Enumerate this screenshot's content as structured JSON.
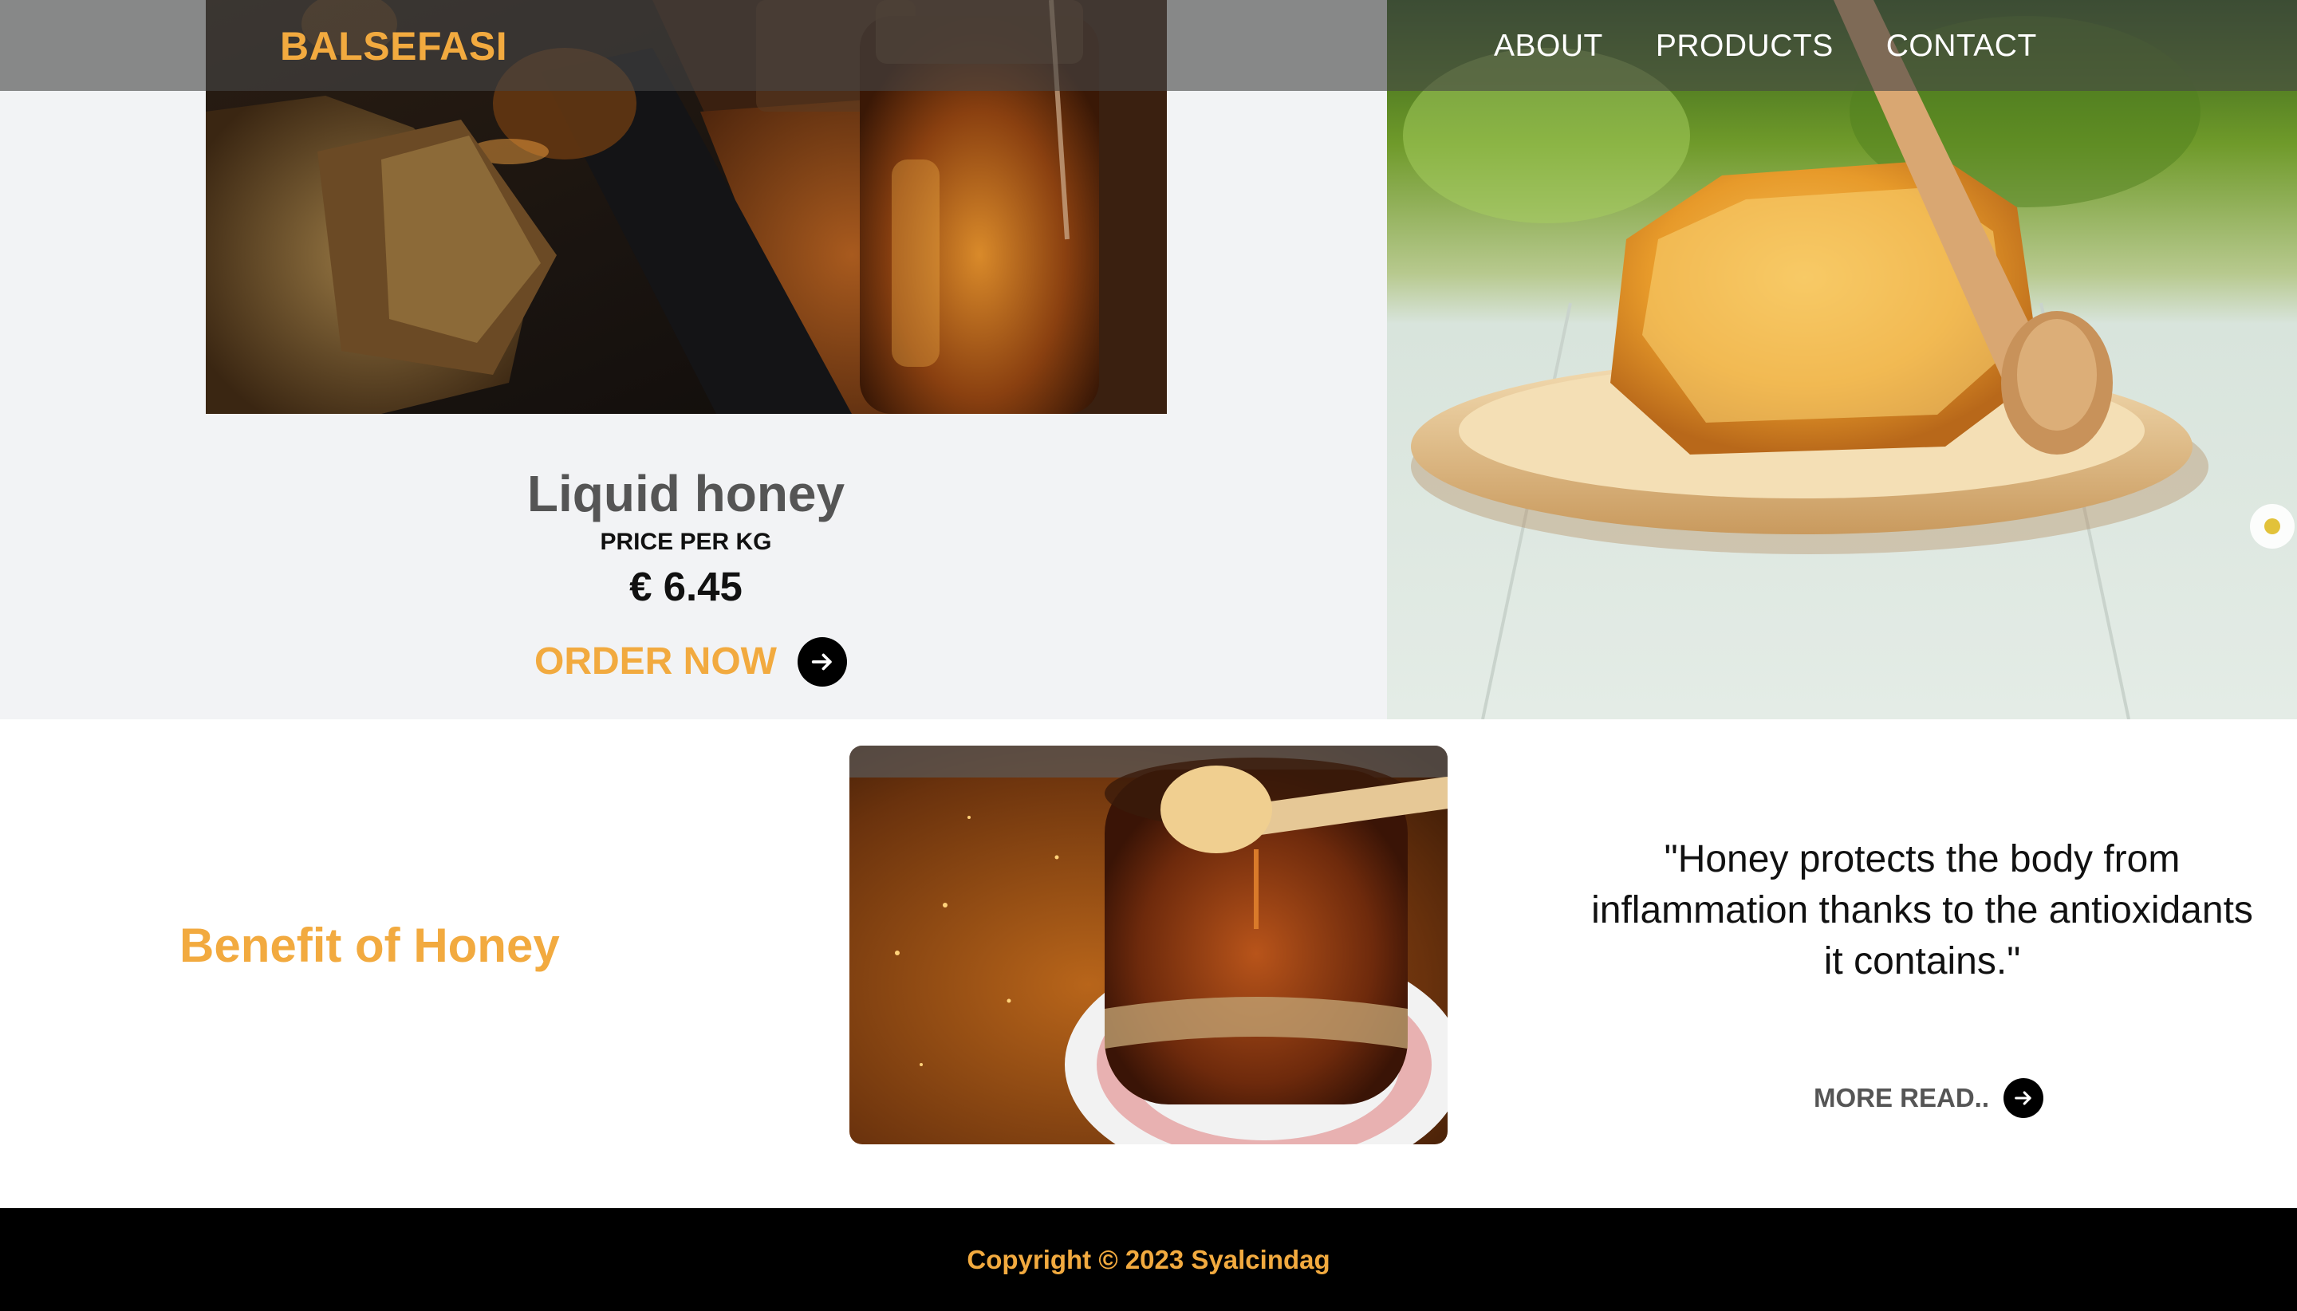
{
  "header": {
    "brand": "BALSEFASI",
    "nav": [
      "ABOUT",
      "PRODUCTS",
      "CONTACT"
    ]
  },
  "hero": {
    "product_name": "Liquid honey",
    "price_label": "PRICE PER KG",
    "price": "€ 6.45",
    "order_label": "ORDER NOW",
    "left_image": "jars-of-honey-with-honeycomb-photo",
    "right_image": "honeycomb-on-wooden-plate-with-dipper-photo"
  },
  "benefit": {
    "title": "Benefit of Honey",
    "image": "honey-jar-with-dipper-photo",
    "quote": "\"Honey protects the body from inflammation thanks to the antioxidants it contains.\"",
    "more_label": "MORE READ.."
  },
  "footer": {
    "copyright": "Copyright © 2023 Syalcindag"
  },
  "colors": {
    "accent": "#f2aa3f",
    "hero_bg": "#f2f3f5",
    "footer_bg": "#000000",
    "text_gray": "#555555"
  }
}
